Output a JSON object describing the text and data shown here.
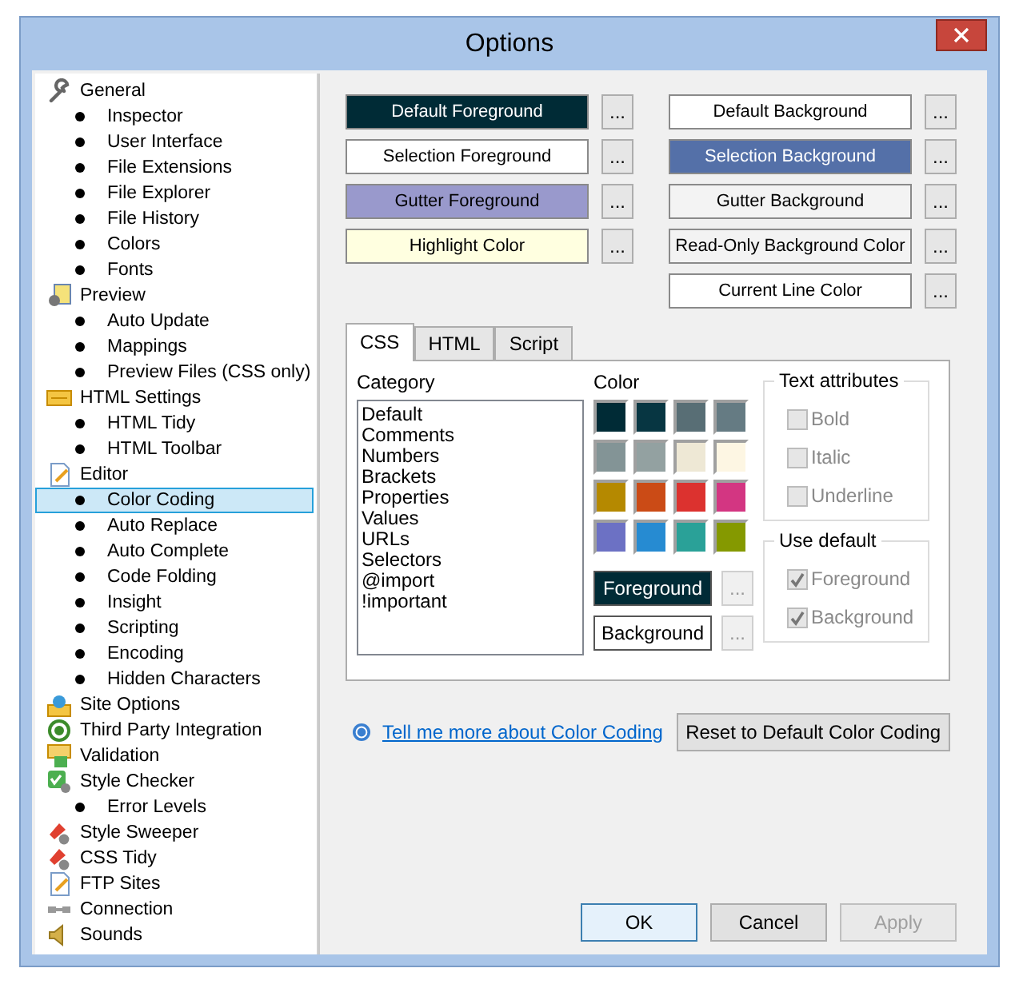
{
  "window": {
    "title": "Options"
  },
  "tree": [
    {
      "label": "General",
      "selected": false,
      "children": [
        {
          "label": "Inspector",
          "selected": false
        },
        {
          "label": "User Interface",
          "selected": false
        },
        {
          "label": "File Extensions",
          "selected": false
        },
        {
          "label": "File Explorer",
          "selected": false
        },
        {
          "label": "File History",
          "selected": false
        },
        {
          "label": "Colors",
          "selected": false
        },
        {
          "label": "Fonts",
          "selected": false
        }
      ]
    },
    {
      "label": "Preview",
      "selected": false,
      "children": [
        {
          "label": "Auto Update",
          "selected": false
        },
        {
          "label": "Mappings",
          "selected": false
        },
        {
          "label": "Preview Files (CSS only)",
          "selected": false
        }
      ]
    },
    {
      "label": "HTML Settings",
      "selected": false,
      "children": [
        {
          "label": "HTML Tidy",
          "selected": false
        },
        {
          "label": "HTML Toolbar",
          "selected": false
        }
      ]
    },
    {
      "label": "Editor",
      "selected": false,
      "children": [
        {
          "label": "Color Coding",
          "selected": true
        },
        {
          "label": "Auto Replace",
          "selected": false
        },
        {
          "label": "Auto Complete",
          "selected": false
        },
        {
          "label": "Code Folding",
          "selected": false
        },
        {
          "label": "Insight",
          "selected": false
        },
        {
          "label": "Scripting",
          "selected": false
        },
        {
          "label": "Encoding",
          "selected": false
        },
        {
          "label": "Hidden Characters",
          "selected": false
        }
      ]
    },
    {
      "label": "Site Options",
      "selected": false
    },
    {
      "label": "Third Party Integration",
      "selected": false
    },
    {
      "label": "Validation",
      "selected": false
    },
    {
      "label": "Style Checker",
      "selected": false,
      "children": [
        {
          "label": "Error Levels",
          "selected": false
        }
      ]
    },
    {
      "label": "Style Sweeper",
      "selected": false
    },
    {
      "label": "CSS Tidy",
      "selected": false
    },
    {
      "label": "FTP Sites",
      "selected": false
    },
    {
      "label": "Connection",
      "selected": false
    },
    {
      "label": "Sounds",
      "selected": false
    }
  ],
  "color_buttons_left": [
    {
      "label": "Default Foreground",
      "color": "#002b36",
      "more": "..."
    },
    {
      "label": "Selection Foreground",
      "color": "#ffffff",
      "more": "..."
    },
    {
      "label": "Gutter Foreground",
      "color": "#9999cc",
      "more": "..."
    },
    {
      "label": "Highlight Color",
      "color": "#ffffe0",
      "more": "..."
    }
  ],
  "color_buttons_right": [
    {
      "label": "Default Background",
      "color": "#ffffff",
      "more": "..."
    },
    {
      "label": "Selection Background",
      "color": "#5470a8",
      "more": "..."
    },
    {
      "label": "Gutter Background",
      "color": "#f3f3f3",
      "more": "..."
    },
    {
      "label": "Read-Only Background Color",
      "color": "#f3f3f3",
      "more": "..."
    },
    {
      "label": "Current Line Color",
      "color": "#ffffff",
      "more": "..."
    }
  ],
  "tabs": [
    {
      "label": "CSS",
      "selected": true
    },
    {
      "label": "HTML",
      "selected": false
    },
    {
      "label": "Script",
      "selected": false
    }
  ],
  "category": {
    "label": "Category",
    "items": [
      "Default",
      "Comments",
      "Numbers",
      "Brackets",
      "Properties",
      "Values",
      "URLs",
      "Selectors",
      "@import",
      "!important"
    ]
  },
  "color": {
    "label": "Color",
    "swatches": [
      {
        "color": "#002b36"
      },
      {
        "color": "#073642"
      },
      {
        "color": "#586e75"
      },
      {
        "color": "#657b83"
      },
      {
        "color": "#839496"
      },
      {
        "color": "#93a1a1"
      },
      {
        "color": "#eee8d5"
      },
      {
        "color": "#fdf6e3"
      },
      {
        "color": "#b58900"
      },
      {
        "color": "#cb4b16"
      },
      {
        "color": "#dc322f"
      },
      {
        "color": "#d33682"
      },
      {
        "color": "#6c71c4"
      },
      {
        "color": "#268bd2"
      },
      {
        "color": "#2aa198"
      },
      {
        "color": "#859900"
      }
    ],
    "buttons": [
      {
        "label": "Foreground",
        "color": "#002b36",
        "more": "...",
        "more_disabled": true
      },
      {
        "label": "Background",
        "color": "#ffffff",
        "more": "...",
        "more_disabled": true
      }
    ]
  },
  "text_attributes": {
    "title": "Text attributes",
    "items": [
      {
        "label": "Bold",
        "checked": false,
        "disabled": true
      },
      {
        "label": "Italic",
        "checked": false,
        "disabled": true
      },
      {
        "label": "Underline",
        "checked": false,
        "disabled": true
      }
    ]
  },
  "use_default": {
    "title": "Use default",
    "items": [
      {
        "label": "Foreground",
        "checked": true,
        "disabled": true
      },
      {
        "label": "Background",
        "checked": true,
        "disabled": true
      }
    ]
  },
  "help_link": "Tell me more about Color Coding",
  "reset_button": "Reset to Default Color Coding",
  "dialog_buttons": [
    {
      "label": "OK",
      "disabled": false,
      "default": true
    },
    {
      "label": "Cancel",
      "disabled": false,
      "default": false
    },
    {
      "label": "Apply",
      "disabled": true,
      "default": false
    }
  ]
}
